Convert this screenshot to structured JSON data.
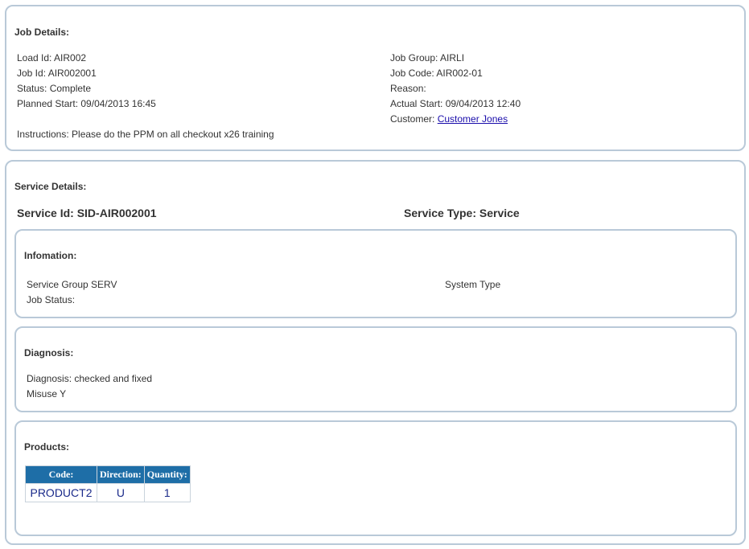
{
  "job_details": {
    "title": "Job Details:",
    "load_id": "Load Id: AIR002",
    "job_id": "Job Id: AIR002001",
    "status": "Status: Complete",
    "planned_start": "Planned Start: 09/04/2013 16:45",
    "instructions": "Instructions: Please do the PPM on all checkout x26 training",
    "job_group": "Job Group: AIRLI",
    "job_code": "Job Code: AIR002-01",
    "reason": "Reason:",
    "actual_start": "Actual Start: 09/04/2013 12:40",
    "customer_label": "Customer:",
    "customer_link": "Customer Jones"
  },
  "service_details": {
    "title": "Service Details:",
    "service_id": "Service Id: SID-AIR002001",
    "service_type": "Service Type: Service",
    "information": {
      "title": "Infomation:",
      "service_group": "Service Group SERV",
      "job_status": "Job Status:",
      "system_type": "System Type"
    },
    "diagnosis": {
      "title": "Diagnosis:",
      "diagnosis": "Diagnosis: checked and fixed",
      "misuse": "Misuse Y"
    },
    "products": {
      "title": "Products:",
      "columns": [
        "Code:",
        "Direction:",
        "Quantity:"
      ],
      "rows": [
        [
          "PRODUCT2",
          "U",
          "1"
        ]
      ]
    }
  },
  "colors": {
    "panel_border": "#b9c9d8",
    "table_header": "#1e6ea7",
    "table_text": "#1a2a8a",
    "link": "#1a0dab"
  }
}
